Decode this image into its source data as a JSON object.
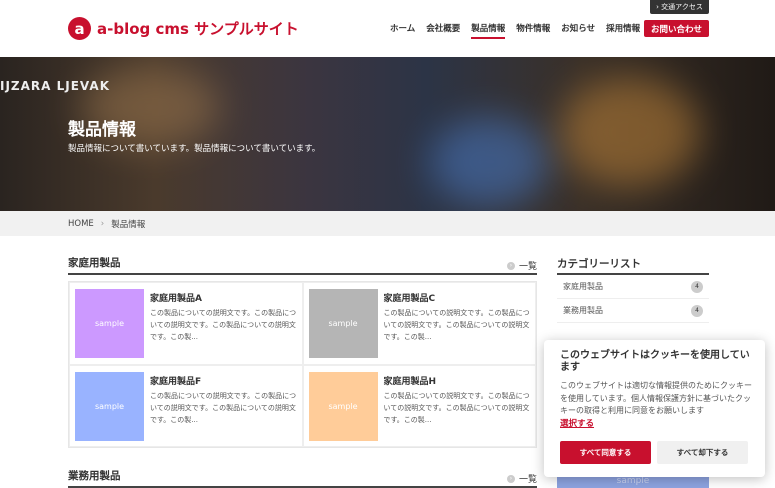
{
  "header": {
    "logo_mark": "a",
    "logo_text": "a-blog cms サンプルサイト",
    "access": "› 交通アクセス",
    "nav": [
      "ホーム",
      "会社概要",
      "製品情報",
      "物件情報",
      "お知らせ",
      "採用情報"
    ],
    "contact": "お問い合わせ"
  },
  "hero": {
    "sign": "IJZARA LJEVAK",
    "title": "製品情報",
    "subtitle": "製品情報について書いています。製品情報について書いています。"
  },
  "breadcrumb": [
    "HOME",
    "›",
    "製品情報"
  ],
  "sections": [
    {
      "title": "家庭用製品",
      "more": "一覧"
    },
    {
      "title": "業務用製品",
      "more": "一覧"
    }
  ],
  "products": [
    {
      "name": "家庭用製品A",
      "thumb": "sample",
      "color": "#cc99ff",
      "desc": "この製品についての説明文です。この製品についての説明文です。この製品についての説明文です。この製..."
    },
    {
      "name": "家庭用製品C",
      "thumb": "sample",
      "color": "#b5b5b5",
      "desc": "この製品についての説明文です。この製品についての説明文です。この製品についての説明文です。この製..."
    },
    {
      "name": "家庭用製品F",
      "thumb": "sample",
      "color": "#99b3ff",
      "desc": "この製品についての説明文です。この製品についての説明文です。この製品についての説明文です。この製..."
    },
    {
      "name": "家庭用製品H",
      "thumb": "sample",
      "color": "#ffcc99",
      "desc": "この製品についての説明文です。この製品についての説明文です。この製品についての説明文です。この製..."
    }
  ],
  "sidebar": {
    "title": "カテゴリーリスト",
    "categories": [
      {
        "label": "家庭用製品",
        "count": "4"
      },
      {
        "label": "業務用製品",
        "count": "4"
      }
    ],
    "image_label": "sample"
  },
  "cookie": {
    "title": "このウェブサイトはクッキーを使用しています",
    "body": "このウェブサイトは適切な情報提供のためにクッキーを使用しています。個人情報保護方針に基づいたクッキーの取得と利用に同意をお願いします",
    "link": "選択する",
    "accept": "すべて同意する",
    "reject": "すべて却下する"
  }
}
